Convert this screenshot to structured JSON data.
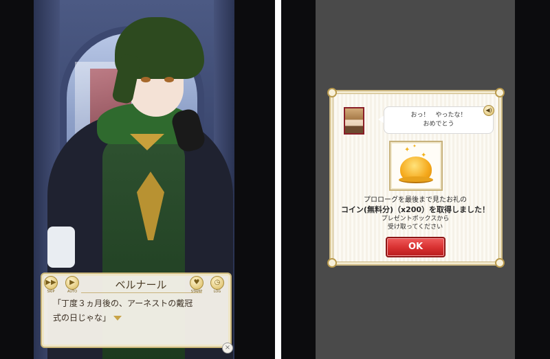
{
  "left_screen": {
    "controls": {
      "skip": "SKIP",
      "auto": "AUTO",
      "stamp": "STAMP",
      "log": "LOG"
    },
    "speaker_name": "ベルナール",
    "dialogue_line1": "「丁度３ヵ月後の、アーネストの戴冠",
    "dialogue_line2": "式の日じゃな」",
    "close_glyph": "×"
  },
  "right_screen": {
    "bubble_line1": "おっ！　やったな！",
    "bubble_line2": "おめでとう",
    "message_line1": "プロローグを最後まで見たお礼の",
    "message_line2": "コイン(無料分)（x200）を取得しました！",
    "message_line3": "プレゼントボックスから",
    "message_line4": "受け取ってください",
    "ok_button": "OK",
    "volume_glyph": "◀)",
    "icons": [
      "speaker-portrait",
      "volume-icon",
      "coin-pile-icon",
      "sparkle-icon"
    ]
  },
  "colors": {
    "ok_red": "#d73030",
    "frame_gold": "#cdb882",
    "coin_orange": "#f5a91c"
  }
}
